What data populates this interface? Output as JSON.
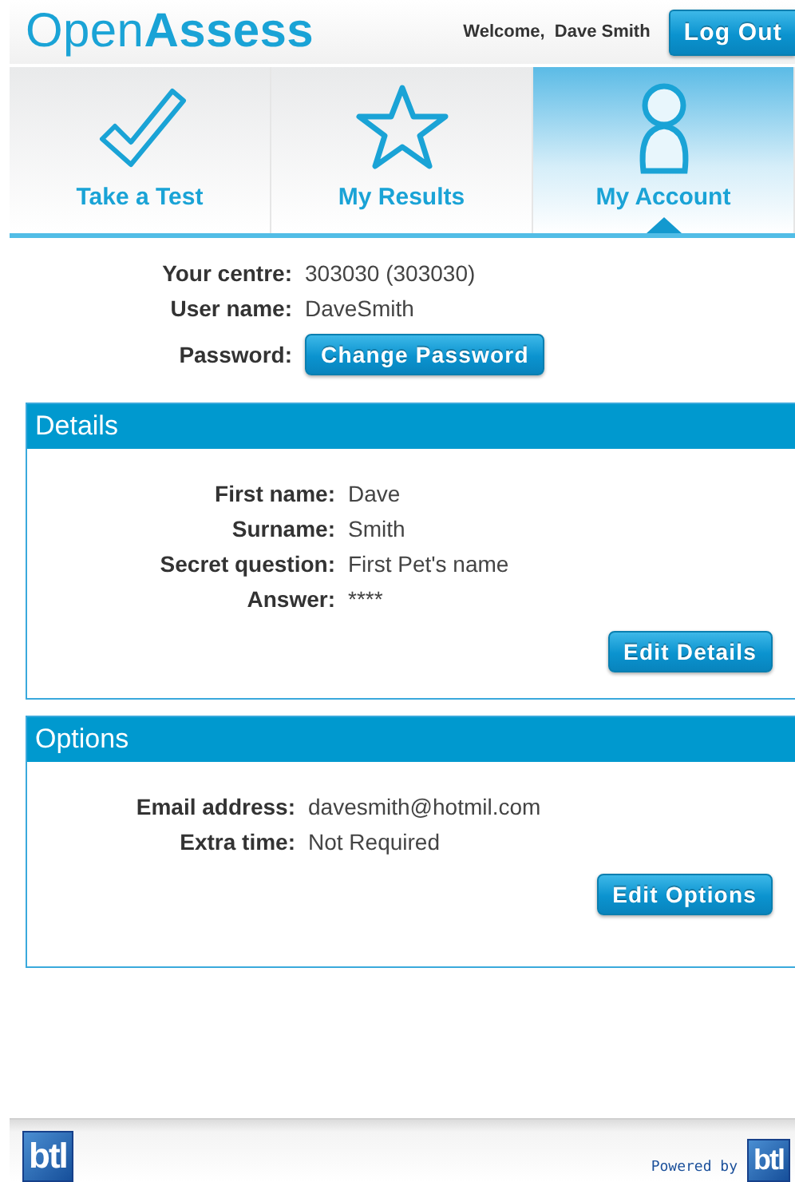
{
  "header": {
    "logo": "Open**Assess**",
    "welcome": "Welcome,  Dave Smith",
    "logout": "Log Out"
  },
  "tabs": [
    {
      "label": "Take a Test",
      "selected": false
    },
    {
      "label": "My Results",
      "selected": false
    },
    {
      "label": "My Account",
      "selected": true
    }
  ],
  "account": {
    "fields": [
      {
        "label": "Your centre:",
        "value": "303030 (303030)"
      },
      {
        "label": "User name:",
        "value": "DaveSmith"
      }
    ],
    "password": {
      "label": "Password:",
      "button": "Change Password"
    }
  },
  "panels": [
    {
      "title": "Details",
      "fields": [
        {
          "label": "First name:",
          "value": "Dave"
        },
        {
          "label": "Surname:",
          "value": "Smith"
        },
        {
          "label": "Secret question:",
          "value": "First Pet's name"
        },
        {
          "label": "Answer:",
          "value": "****"
        }
      ],
      "button": "Edit Details"
    },
    {
      "title": "Options",
      "fields": [
        {
          "label": "Email address:",
          "value": "davesmith@hotmil.com"
        },
        {
          "label": "Extra time:",
          "value": "Not Required"
        }
      ],
      "button": "Edit Options"
    }
  ],
  "footer": {
    "logo": "btl",
    "powered_by": "Powered by",
    "powered_logo": "btl"
  }
}
